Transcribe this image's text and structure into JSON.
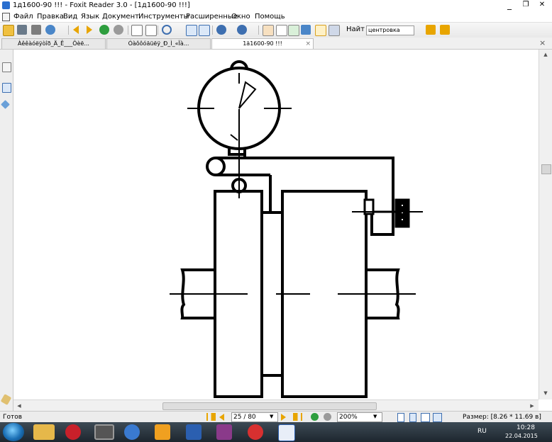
{
  "window": {
    "title": "1д1600-90 !!! - Foxit Reader 3.0 - [1д1600-90 !!!]",
    "minimize": "_",
    "restore": "❐",
    "close": "✕"
  },
  "menu": [
    "Файл",
    "Правка",
    "Вид",
    "Язык",
    "Документ",
    "Инструменты",
    "Расширенные",
    "Окно",
    "Помощь"
  ],
  "toolbar": {
    "find_label": "Найт",
    "find_value": "центровка"
  },
  "tabs": [
    {
      "label": "Àêêàóëÿòîð_Ä_Ê___Ôèë..."
    },
    {
      "label": "Óàôôóäüëÿ_Ð_Ì_«Ïà..."
    },
    {
      "label": "1ä1600-90 !!!",
      "active": true
    }
  ],
  "tab_close": "×",
  "status": {
    "ready": "Готов",
    "page_value": "25 / 80",
    "zoom_value": "200%",
    "size_label": "Размер: [8.26 * 11.69 в]"
  },
  "taskbar": {
    "lang": "RU",
    "time": "10:28",
    "date": "22.04.2015"
  },
  "colors": {
    "toolbar_bg": "#ececec",
    "taskbar_bg": "#2b3640",
    "drawing": "#000000",
    "accent_orange": "#e8a500",
    "accent_green": "#2e9e3e"
  }
}
